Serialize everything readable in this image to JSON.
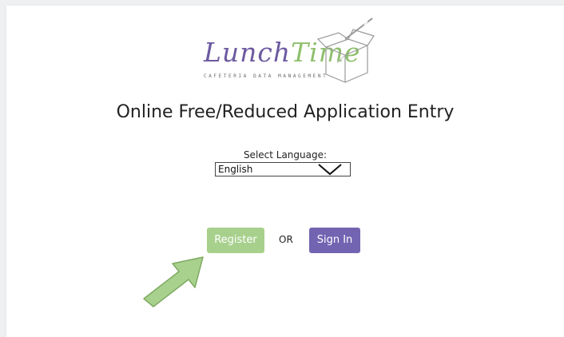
{
  "logo": {
    "word_part1": "Lunch",
    "word_part2": "Time",
    "tagline": "CAFETERIA DATA MANAGEMENT"
  },
  "page": {
    "title": "Online Free/Reduced Application Entry"
  },
  "language": {
    "label": "Select Language:",
    "selected": "English"
  },
  "actions": {
    "register_label": "Register",
    "or_label": "OR",
    "signin_label": "Sign In"
  },
  "colors": {
    "brand_purple": "#6d5aa0",
    "brand_green": "#8fbf6c",
    "register_button": "#a8d08d",
    "signin_button": "#7364b2",
    "arrow_fill": "#a9d18e",
    "arrow_stroke": "#7faa62"
  },
  "icons": {
    "language_dropdown": "chevron-down-icon",
    "logo_graphic": "lunchbox-icon",
    "pointer": "arrow-pointer-icon"
  }
}
